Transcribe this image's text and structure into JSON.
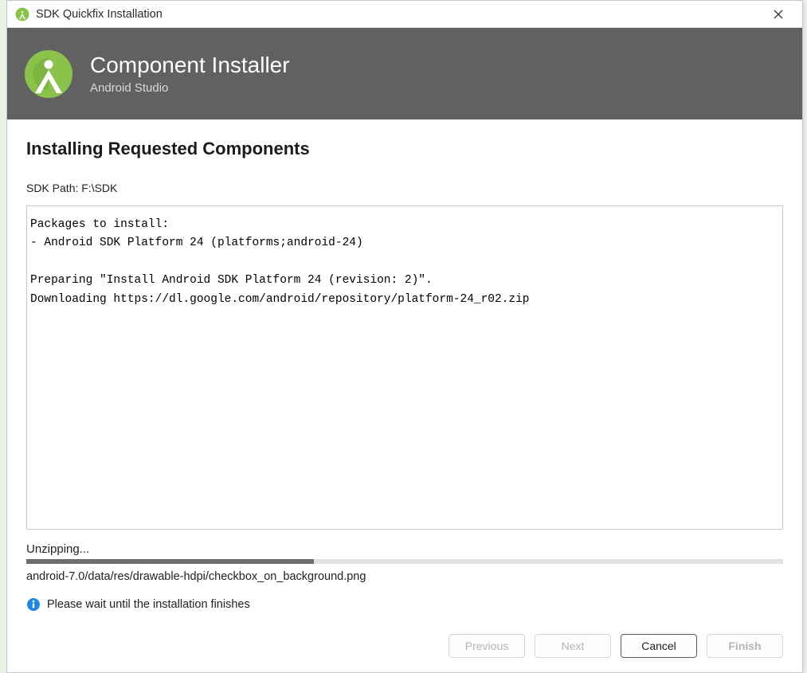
{
  "titlebar": {
    "title": "SDK Quickfix Installation"
  },
  "banner": {
    "heading": "Component Installer",
    "subheading": "Android Studio"
  },
  "content": {
    "section_title": "Installing Requested Components",
    "sdk_path_label": "SDK Path:   F:\\SDK",
    "log_text": "Packages to install:\n- Android SDK Platform 24 (platforms;android-24)\n\nPreparing \"Install Android SDK Platform 24 (revision: 2)\".\nDownloading https://dl.google.com/android/repository/platform-24_r02.zip"
  },
  "progress": {
    "status_label": "Unzipping...",
    "current_file": "android-7.0/data/res/drawable-hdpi/checkbox_on_background.png",
    "percent": 38,
    "wait_message": "Please wait until the installation finishes"
  },
  "footer": {
    "previous_label": "Previous",
    "next_label": "Next",
    "cancel_label": "Cancel",
    "finish_label": "Finish"
  },
  "colors": {
    "accent_green": "#8bc34a",
    "accent_dark_green": "#689f38",
    "banner_bg": "#616161",
    "info_blue": "#1e88e5"
  }
}
